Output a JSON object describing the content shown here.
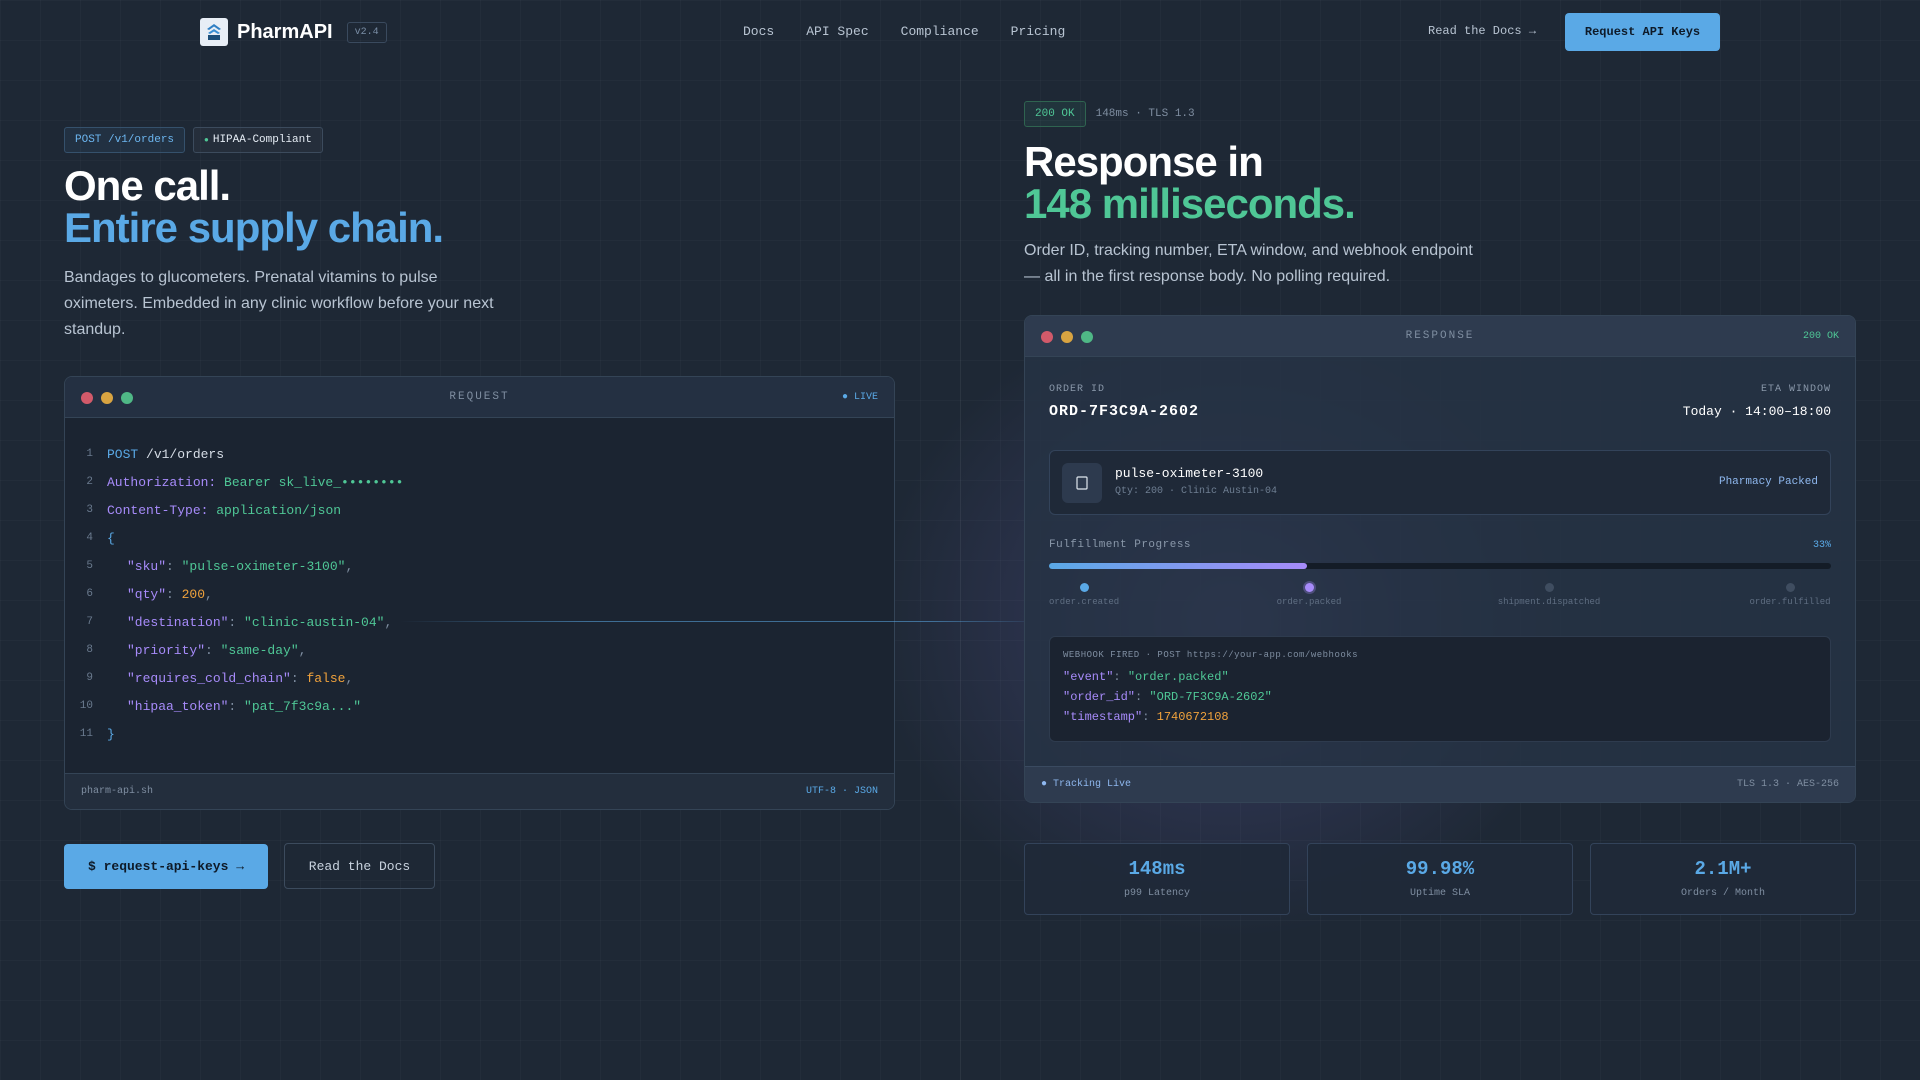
{
  "nav": {
    "brand": "PharmAPI",
    "version": "v2.4",
    "links": [
      "Docs",
      "API Spec",
      "Compliance",
      "Pricing"
    ],
    "docs_link": "Read the Docs →",
    "cta": "Request API Keys"
  },
  "left": {
    "badge_endpoint": "POST /v1/orders",
    "badge_hipaa": "HIPAA-Compliant",
    "headline_1": "One call.",
    "headline_2": "Entire supply chain.",
    "lead": "Bandages to glucometers. Prenatal vitamins to pulse oximeters. Embedded in any clinic workflow before your next standup."
  },
  "request": {
    "title": "REQUEST",
    "status": "● LIVE",
    "footer_left": "pharm-api.sh",
    "footer_right": "UTF-8 · JSON",
    "lines": {
      "l1_method": "POST",
      "l1_path": " /v1/orders",
      "l2_key": "Authorization:",
      "l2_val": " Bearer sk_live_••••••••",
      "l3_key": "Content-Type:",
      "l3_val": " application/json",
      "l4": "{",
      "sku_k": "\"sku\"",
      "sku_v": "\"pulse-oximeter-3100\"",
      "qty_k": "\"qty\"",
      "qty_v": "200",
      "dest_k": "\"destination\"",
      "dest_v": "\"clinic-austin-04\"",
      "prio_k": "\"priority\"",
      "prio_v": "\"same-day\"",
      "cold_k": "\"requires_cold_chain\"",
      "cold_v": "false",
      "tok_k": "\"hipaa_token\"",
      "tok_v": "\"pat_7f3c9a...\"",
      "l11": "}"
    }
  },
  "buttons": {
    "primary": "$ request-api-keys →",
    "secondary": "Read the Docs"
  },
  "right": {
    "status_badge": "200 OK",
    "status_meta": "148ms · TLS 1.3",
    "headline_1": "Response in",
    "headline_2": "148 milliseconds.",
    "lead": "Order ID, tracking number, ETA window, and webhook endpoint — all in the first response body. No polling required."
  },
  "response": {
    "title": "RESPONSE",
    "status": "200 OK",
    "order_label": "ORDER ID",
    "order_id": "ORD-7F3C9A-2602",
    "eta_label": "ETA WINDOW",
    "eta_value": "Today · 14:00–18:00",
    "item_name": "pulse-oximeter-3100",
    "item_meta": "Qty: 200 · Clinic Austin-04",
    "item_status": "Pharmacy Packed",
    "progress_label": "Fulfillment Progress",
    "progress_pct": "33%",
    "progress_value": 0.33,
    "steps": [
      "order.created",
      "order.packed",
      "shipment.dispatched",
      "order.fulfilled"
    ],
    "webhook_title": "WEBHOOK FIRED · POST https://your-app.com/webhooks",
    "wh_event_k": "\"event\"",
    "wh_event_v": "\"order.packed\"",
    "wh_order_k": "\"order_id\"",
    "wh_order_v": "\"ORD-7F3C9A-2602\"",
    "wh_ts_k": "\"timestamp\"",
    "wh_ts_v": "1740672108",
    "footer_left": "● Tracking Live",
    "footer_right": "TLS 1.3 · AES-256"
  },
  "stats": [
    {
      "value": "148ms",
      "label": "p99 Latency"
    },
    {
      "value": "99.98%",
      "label": "Uptime SLA"
    },
    {
      "value": "2.1M+",
      "label": "Orders / Month"
    }
  ],
  "colors": {
    "accent_blue": "#5aa9e6",
    "accent_green": "#4fc796",
    "accent_purple": "#a78bfa",
    "accent_orange": "#f0a23c",
    "background": "#1e2835"
  }
}
